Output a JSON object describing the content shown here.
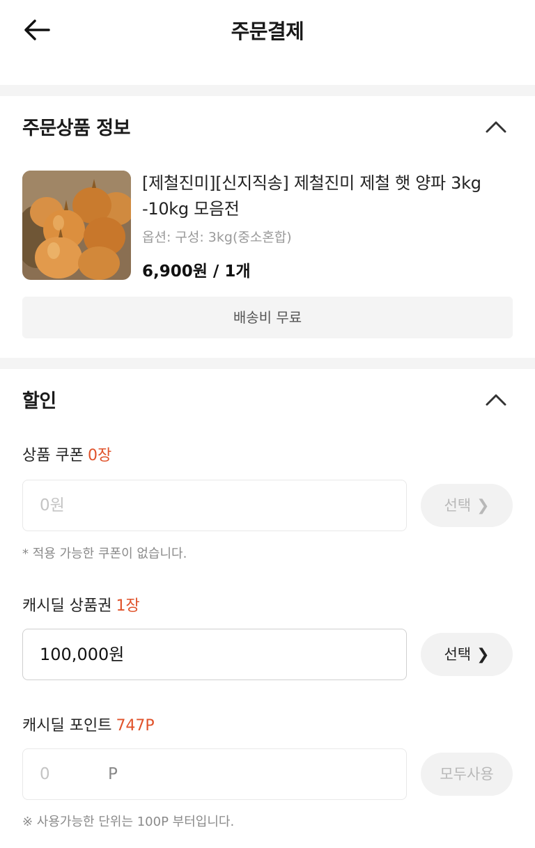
{
  "header": {
    "title": "주문결제"
  },
  "order_section": {
    "title": "주문상품 정보",
    "product": {
      "name": "[제철진미][신지직송] 제철진미 제철 햇 양파 3kg -10kg 모음전",
      "option": "옵션: 구성: 3kg(중소혼합)",
      "price_qty": "6,900원 / 1개",
      "image": "onion-photo"
    },
    "shipping": "배송비 무료"
  },
  "discount_section": {
    "title": "할인",
    "product_coupon": {
      "label": "상품 쿠폰",
      "count": "0장",
      "value": "0원",
      "button": "선택",
      "note": "* 적용 가능한 쿠폰이 없습니다."
    },
    "gift_card": {
      "label": "캐시딜 상품권",
      "count": "1장",
      "value": "100,000원",
      "button": "선택"
    },
    "points": {
      "label": "캐시딜 포인트",
      "count": "747P",
      "value": "0",
      "unit": "P",
      "button": "모두사용",
      "note": "※ 사용가능한 단위는 100P 부터입니다."
    }
  },
  "colors": {
    "accent": "#e0522a",
    "divider": "#f4f4f4"
  },
  "icons": {
    "back": "arrow-left-icon",
    "collapse": "chevron-up-icon",
    "select": "chevron-right-icon"
  }
}
